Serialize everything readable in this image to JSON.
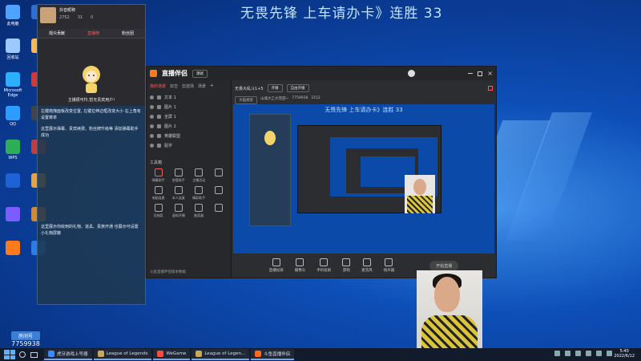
{
  "banner": "无畏先锋 上车请办卡》连胜 33",
  "desktop_icons": [
    {
      "label": "此电脑",
      "color": "#4da3ff"
    },
    {
      "label": "",
      "color": "#2e6fd1"
    },
    {
      "label": "回收站",
      "color": "#9cc9ff"
    },
    {
      "label": "",
      "color": "#ffb84d"
    },
    {
      "label": "Microsoft Edge",
      "color": "#2ab0ff"
    },
    {
      "label": "",
      "color": "#d33"
    },
    {
      "label": "QQ",
      "color": "#2d9cff"
    },
    {
      "label": "",
      "color": "#444"
    },
    {
      "label": "WPS",
      "color": "#2fae5a"
    },
    {
      "label": "",
      "color": "#c93a3a"
    },
    {
      "label": "",
      "color": "#1f62d6"
    },
    {
      "label": "",
      "color": "#e8a33a"
    },
    {
      "label": "",
      "color": "#7b5cff"
    },
    {
      "label": "",
      "color": "#d9892a"
    },
    {
      "label": "",
      "color": "#ff7a1a"
    },
    {
      "label": "",
      "color": "#2b7de9"
    }
  ],
  "overlay": {
    "username": "抖音昵称",
    "count_a": "2752",
    "count_b": "31",
    "count_c": "0",
    "tabs": [
      "观众贡献",
      "直播榜",
      "粉丝团"
    ],
    "char_caption": "主播很可怜,暂无贵宾用户!",
    "text1": "左键拖拽面板改变位置, 左键拉伸边框改变大小 右上角有设置菜单",
    "text2": "这里展示弹幕、贵宾续费、粉丝牌升级等 添加弹幕助手成功",
    "text3": "这里展示你收到的礼物、道具、贵族开通 也展示可设置小礼物屏蔽"
  },
  "app": {
    "logo": "直播伴侣",
    "badge": "测试",
    "side_tabs": [
      "我的场景",
      "双击",
      "剪迹场",
      "场景"
    ],
    "sources": [
      "文本 1",
      "图片 1",
      "全屏 1",
      "图片 2",
      "英雄联盟",
      "贴字"
    ],
    "tools_title": "工具箱",
    "tools": [
      {
        "label": "弹幕助手",
        "red": true
      },
      {
        "label": "房管助手",
        "red": false
      },
      {
        "label": "主播活动",
        "red": false
      },
      {
        "label": "",
        "red": false
      },
      {
        "label": "电脑连麦",
        "red": false
      },
      {
        "label": "本人连麦",
        "red": false
      },
      {
        "label": "精彩助手",
        "red": false
      },
      {
        "label": "",
        "red": false
      },
      {
        "label": "设抽奖",
        "red": false
      },
      {
        "label": "虚拟开播",
        "red": false
      },
      {
        "label": "抽奖器",
        "red": false
      },
      {
        "label": "",
        "red": false
      }
    ],
    "footer_text": "斗鱼直播伴侣版本数据",
    "room_title": "无畏先锋 上车请办卡》连胜 33",
    "room_name": "无畏大乱斗1+5",
    "tags": [
      "开播",
      "自由开播",
      "大猫视觉",
      "山城大乙大完游~",
      "7759938",
      "2152"
    ],
    "bottom_actions": [
      "直播投屏",
      "摄像头",
      "手机投屏",
      "游戏",
      "麦克风",
      "扬声器"
    ],
    "start_button": "开始直播"
  },
  "stat": {
    "label": "房间号",
    "value": "7759938"
  },
  "taskbar": {
    "items": [
      {
        "label": "虎牙游戏上号器",
        "color": "#3b8bff"
      },
      {
        "label": "League of Legends",
        "color": "#c9a85c"
      },
      {
        "label": "WeGame",
        "color": "#ff4a3d"
      },
      {
        "label": "League of Legen...",
        "color": "#c9a85c"
      },
      {
        "label": "斗鱼直播伴侣",
        "color": "#ff6a1a"
      }
    ],
    "time": "5:40",
    "date": "2022/6/12"
  }
}
